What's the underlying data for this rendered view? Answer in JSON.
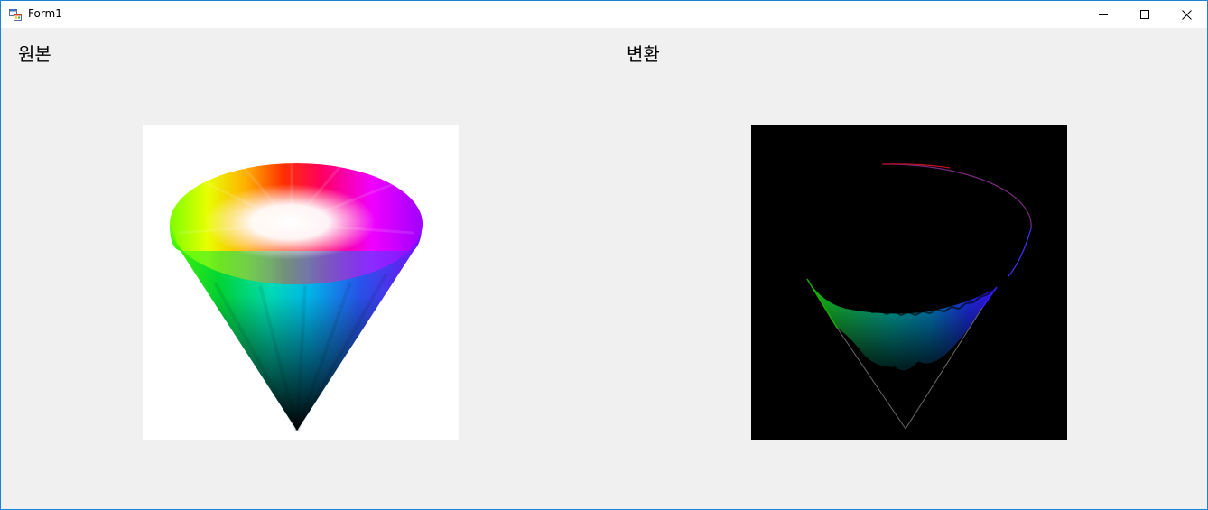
{
  "window": {
    "title": "Form1",
    "icons": {
      "app": "winforms-app-icon",
      "minimize": "minimize-icon",
      "maximize": "maximize-icon",
      "close": "close-icon"
    }
  },
  "labels": {
    "original": "원본",
    "converted": "변환"
  },
  "images": {
    "original": {
      "description_icon": "hsv-cone-image",
      "background": "#ffffff"
    },
    "converted": {
      "description_icon": "converted-cone-image",
      "background": "#000000"
    }
  },
  "colors": {
    "window_border": "#1883d7",
    "client_bg": "#f0f0f0",
    "titlebar_bg": "#ffffff"
  }
}
